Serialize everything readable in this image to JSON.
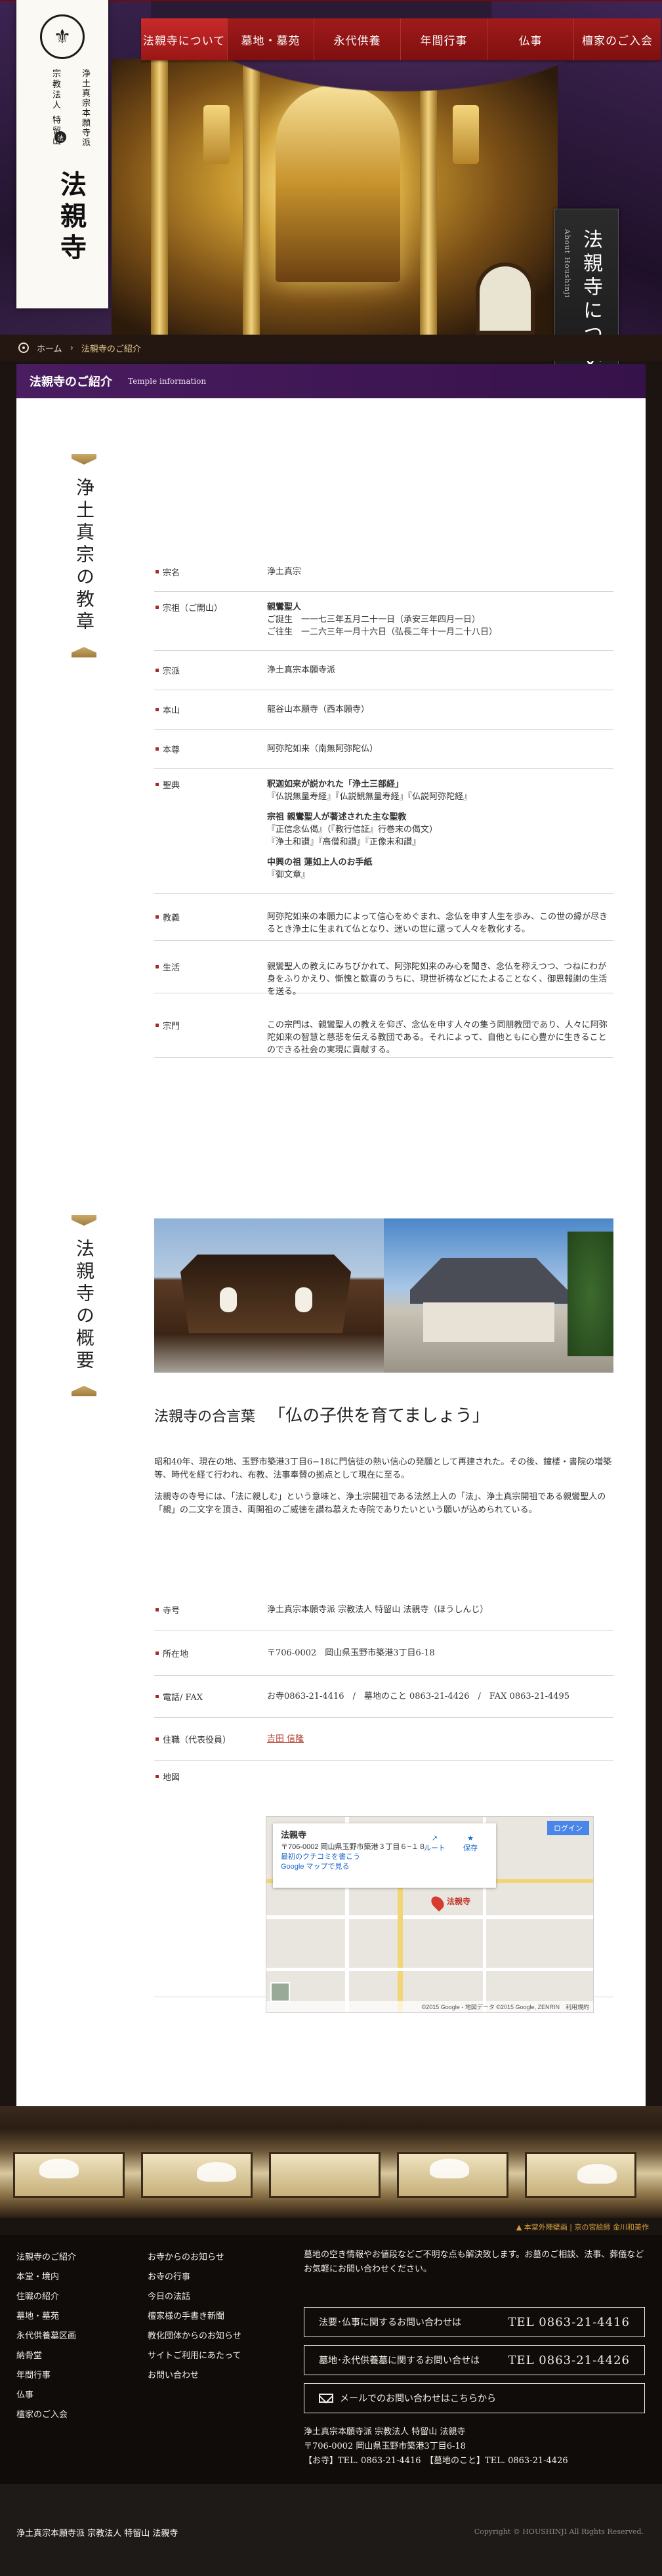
{
  "nav": {
    "items": [
      {
        "label": "法親寺について",
        "active": true
      },
      {
        "label": "墓地・墓苑"
      },
      {
        "label": "永代供養"
      },
      {
        "label": "年間行事"
      },
      {
        "label": "仏事"
      },
      {
        "label": "檀家のご入会"
      }
    ]
  },
  "logo": {
    "sect": "浄土真宗本願寺派",
    "corp": "宗教法人 特留山",
    "name": "法親寺",
    "mark": "法"
  },
  "banner": {
    "title": "法親寺について",
    "subtitle": "About Houshinji"
  },
  "breadcrumb": {
    "home": "ホーム",
    "sep": "›",
    "current": "法親寺のご紹介"
  },
  "section_bar": {
    "title": "法親寺のご紹介",
    "subtitle": "Temple information"
  },
  "teaching": {
    "side_title": "浄土真宗の教章",
    "rows": [
      {
        "label": "宗名",
        "lines": [
          "浄土真宗"
        ]
      },
      {
        "label": "宗祖（ご開山）",
        "lines": [
          "親鸞聖人",
          "ご誕生　一一七三年五月二十一日（承安三年四月一日）",
          "ご往生　一二六三年一月十六日（弘長二年十一月二十八日）"
        ]
      },
      {
        "label": "宗派",
        "lines": [
          "浄土真宗本願寺派"
        ]
      },
      {
        "label": "本山",
        "lines": [
          "龍谷山本願寺（西本願寺）"
        ]
      },
      {
        "label": "本尊",
        "lines": [
          "阿弥陀如来（南無阿弥陀仏）"
        ]
      },
      {
        "label": "聖典",
        "lines": [
          "釈迦如来が説かれた「浄土三部経」",
          "『仏説無量寿経』『仏説観無量寿経』『仏説阿弥陀経』",
          "",
          "宗祖 親鸞聖人が著述された主な聖教",
          "『正信念仏偈』（『教行信証』行巻末の偈文）",
          "『浄土和讃』『高僧和讃』『正像末和讃』",
          "",
          "中興の祖 蓮如上人のお手紙",
          "『御文章』"
        ]
      },
      {
        "label": "教義",
        "lines": [
          "阿弥陀如来の本願力によって信心をめぐまれ、念仏を申す人生を歩み、この世の縁が尽きるとき浄土に生まれて仏となり、迷いの世に還って人々を教化する。"
        ]
      },
      {
        "label": "生活",
        "lines": [
          "親鸞聖人の教えにみちびかれて、阿弥陀如来のみ心を聞き、念仏を称えつつ、つねにわが身をふりかえり、慚愧と歓喜のうちに、現世祈祷などにたよることなく、御恩報謝の生活を送る。"
        ]
      },
      {
        "label": "宗門",
        "lines": [
          "この宗門は、親鸞聖人の教えを仰ぎ、念仏を申す人々の集う同朋教団であり、人々に阿弥陀如来の智慧と慈悲を伝える教団である。それによって、自他ともに心豊かに生きることのできる社会の実現に貢献する。"
        ]
      }
    ]
  },
  "overview": {
    "side_title": "法親寺の概要",
    "motto_label": "法親寺の合言葉",
    "motto": "「仏の子供を育てましょう」",
    "para1": "昭和40年、現在の地、玉野市築港3丁目6−18に門信徒の熱い信心の発願として再建された。その後、鐘楼・書院の増築等、時代を経て行われ、布教、法事奉賛の拠点として現在に至る。",
    "para2": "法親寺の寺号には、「法に親しむ」という意味と、浄土宗開祖である法然上人の「法」、浄土真宗開祖である親鸞聖人の「親」の二文字を頂き、両開祖のご威徳を讃ね慕えた寺院でありたいという願いが込められている。",
    "rows": [
      {
        "label": "寺号",
        "value": "浄土真宗本願寺派 宗教法人 特留山 法親寺（ほうしんじ）"
      },
      {
        "label": "所在地",
        "value": "〒706-0002　岡山県玉野市築港3丁目6-18"
      },
      {
        "label": "電話/ FAX",
        "value": "お寺0863-21-4416　/　墓地のこと 0863-21-4426　/　FAX 0863-21-4495"
      },
      {
        "label": "住職（代表役員）",
        "value": "吉田 信隆"
      },
      {
        "label": "地図",
        "value": ""
      }
    ],
    "map": {
      "place": "法親寺",
      "addr": "〒706-0002 岡山県玉野市築港３丁目６−１８",
      "link1": "最初のクチコミを書こう",
      "link2": "Google マップで見る",
      "route": "ルート",
      "save": "保存",
      "login": "ログイン",
      "pin": "法親寺",
      "credit": "©2015 Google - 地図データ ©2015 Google, ZENRIN　利用規約"
    }
  },
  "note": "▲ 本堂外陣壁画 | 京の宮絵師 金川和美作",
  "footer": {
    "col1": [
      "法親寺のご紹介",
      "本堂・境内",
      "住職の紹介",
      "墓地・墓苑",
      "永代供養墓区画",
      "納骨堂",
      "年間行事",
      "仏事",
      "檀家のご入会"
    ],
    "col2": [
      "お寺からのお知らせ",
      "お寺の行事",
      "今日の法話",
      "檀家様の手書き新聞",
      "教化団体からのお知らせ",
      "サイトご利用にあたって",
      "お問い合わせ"
    ],
    "info": "墓地の空き情報やお値段などご不明な点も解決致します。お墓のご相談、法事、葬儀などお気軽にお問い合わせください。",
    "c1_label": "法要･仏事に関するお問い合わせは",
    "c1_tel": "TEL 0863-21-4416",
    "c2_label": "墓地･永代供養墓に関するお問い合せは",
    "c2_tel": "TEL 0863-21-4426",
    "mail": "メールでのお問い合わせはこちらから",
    "addr1": "浄土真宗本願寺派 宗教法人 特留山 法親寺",
    "addr2": "〒706-0002 岡山県玉野市築港3丁目6-18",
    "addr3": "【お寺】TEL. 0863-21-4416　【墓地のこと】TEL. 0863-21-4426"
  },
  "bottom": {
    "left": "浄土真宗本願寺派 宗教法人 特留山 法親寺",
    "copyright": "Copyright © HOUSHINJI All Rights Reserved."
  }
}
